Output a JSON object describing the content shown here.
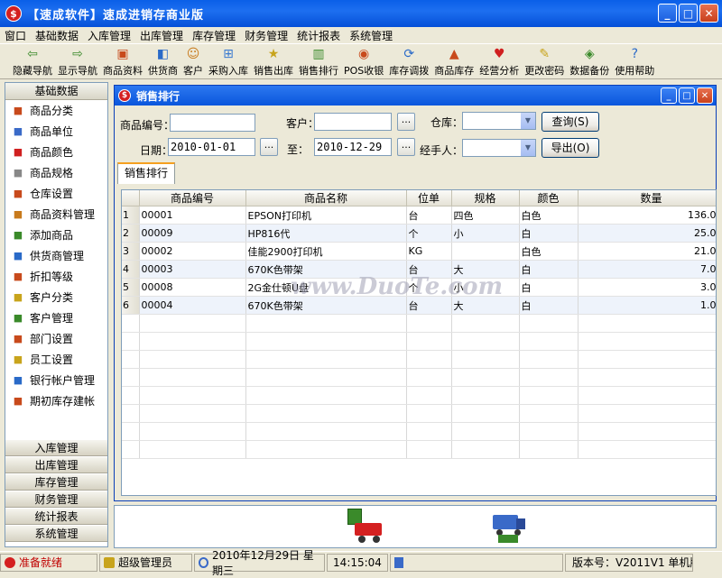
{
  "app": {
    "title": "【速成软件】速成进销存商业版"
  },
  "menu": [
    "窗口",
    "基础数据",
    "入库管理",
    "出库管理",
    "库存管理",
    "财务管理",
    "统计报表",
    "系统管理"
  ],
  "toolbar": [
    {
      "label": "隐藏导航",
      "icon": "arrow-left-icon",
      "color": "#3a8a2a"
    },
    {
      "label": "显示导航",
      "icon": "arrow-right-icon",
      "color": "#3a8a2a"
    },
    {
      "label": "商品资料",
      "icon": "goods-icon",
      "color": "#c84a1c"
    },
    {
      "label": "供货商",
      "icon": "supplier-icon",
      "color": "#2a6ac8"
    },
    {
      "label": "客户",
      "icon": "customer-icon",
      "color": "#c87a1c"
    },
    {
      "label": "采购入库",
      "icon": "purchase-cart-icon",
      "color": "#3a7ad0"
    },
    {
      "label": "销售出库",
      "icon": "sales-icon",
      "color": "#c8a41c"
    },
    {
      "label": "销售排行",
      "icon": "ranking-chart-icon",
      "color": "#3a8a2a"
    },
    {
      "label": "POS收银",
      "icon": "pos-icon",
      "color": "#c84a1c"
    },
    {
      "label": "库存调拨",
      "icon": "transfer-icon",
      "color": "#2a6ac8"
    },
    {
      "label": "商品库存",
      "icon": "stock-icon",
      "color": "#c84a1c"
    },
    {
      "label": "经营分析",
      "icon": "heart-icon",
      "color": "#d02020"
    },
    {
      "label": "更改密码",
      "icon": "password-icon",
      "color": "#c8a41c"
    },
    {
      "label": "数据备份",
      "icon": "backup-icon",
      "color": "#3a8a2a"
    },
    {
      "label": "使用帮助",
      "icon": "help-icon",
      "color": "#2a6ac8"
    }
  ],
  "sidebar": {
    "header": "基础数据",
    "items": [
      "商品分类",
      "商品单位",
      "商品颜色",
      "商品规格",
      "仓库设置",
      "商品资料管理",
      "添加商品",
      "供货商管理",
      "折扣等级",
      "客户分类",
      "客户管理",
      "部门设置",
      "员工设置",
      "银行帐户管理",
      "期初库存建帐"
    ],
    "groups": [
      "入库管理",
      "出库管理",
      "库存管理",
      "财务管理",
      "统计报表",
      "系统管理"
    ]
  },
  "child": {
    "title": "销售排行",
    "labels": {
      "code": "商品编号：",
      "customer": "客户：",
      "warehouse": "仓库：",
      "date": "日期：",
      "to": "至：",
      "handler": "经手人："
    },
    "inputs": {
      "code": "",
      "customer": "",
      "date_from": "2010-01-01",
      "date_to": "2010-12-29",
      "warehouse": "",
      "handler": ""
    },
    "dots": "...",
    "buttons": {
      "query": "查询(S)",
      "export": "导出(O)"
    },
    "tab": "销售排行",
    "columns": [
      "商品编号",
      "商品名称",
      "位单",
      "规格",
      "颜色",
      "数量"
    ],
    "rows": [
      {
        "n": "1",
        "code": "00001",
        "name": "EPSON打印机",
        "unit": "台",
        "spec": "四色",
        "color": "白色",
        "qty": "136.00"
      },
      {
        "n": "2",
        "code": "00009",
        "name": "HP816代",
        "unit": "个",
        "spec": "小",
        "color": "白",
        "qty": "25.00"
      },
      {
        "n": "3",
        "code": "00002",
        "name": "佳能2900打印机",
        "unit": "KG",
        "spec": "",
        "color": "白色",
        "qty": "21.00"
      },
      {
        "n": "4",
        "code": "00003",
        "name": "670K色带架",
        "unit": "台",
        "spec": "大",
        "color": "白",
        "qty": "7.00"
      },
      {
        "n": "5",
        "code": "00008",
        "name": "2G金仕顿U盘",
        "unit": "个",
        "spec": "小",
        "color": "白",
        "qty": "3.00"
      },
      {
        "n": "6",
        "code": "00004",
        "name": "670K色带架",
        "unit": "台",
        "spec": "大",
        "color": "白",
        "qty": "1.00"
      }
    ]
  },
  "watermark": "www.DuoTe.com",
  "status": {
    "ready": "准备就绪",
    "user": "超级管理员",
    "date": "2010年12月29日 星期三",
    "time": "14:15:04",
    "version": "版本号：V2011V1 单机版"
  }
}
